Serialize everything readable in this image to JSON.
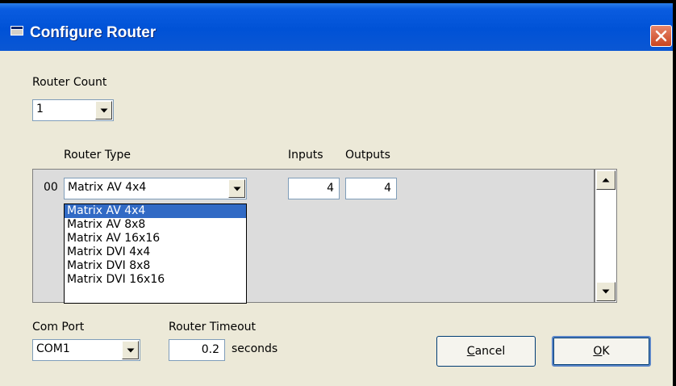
{
  "window": {
    "title": "Configure Router"
  },
  "router_count": {
    "label": "Router Count",
    "value": "1"
  },
  "columns": {
    "router_type": "Router Type",
    "inputs": "Inputs",
    "outputs": "Outputs"
  },
  "row": {
    "index": "00",
    "router_type": "Matrix AV 4x4",
    "inputs": "4",
    "outputs": "4"
  },
  "router_type_options": [
    {
      "label": "Matrix AV 4x4",
      "selected": true
    },
    {
      "label": "Matrix AV 8x8",
      "selected": false
    },
    {
      "label": "Matrix AV 16x16",
      "selected": false
    },
    {
      "label": "Matrix DVI 4x4",
      "selected": false
    },
    {
      "label": "Matrix DVI 8x8",
      "selected": false
    },
    {
      "label": "Matrix DVI 16x16",
      "selected": false
    }
  ],
  "com_port": {
    "label": "Com Port",
    "value": "COM1"
  },
  "router_timeout": {
    "label": "Router Timeout",
    "value": "0.2",
    "unit": "seconds"
  },
  "buttons": {
    "cancel": {
      "label": "Cancel",
      "accel_char": "C",
      "rest": "ancel"
    },
    "ok": {
      "label": "OK",
      "accel_char": "O",
      "rest": "K"
    }
  },
  "colors": {
    "titlebar": "#0052d6",
    "dialog_bg": "#ece9d8",
    "selection": "#316ac5",
    "close_button": "#c9441f"
  }
}
